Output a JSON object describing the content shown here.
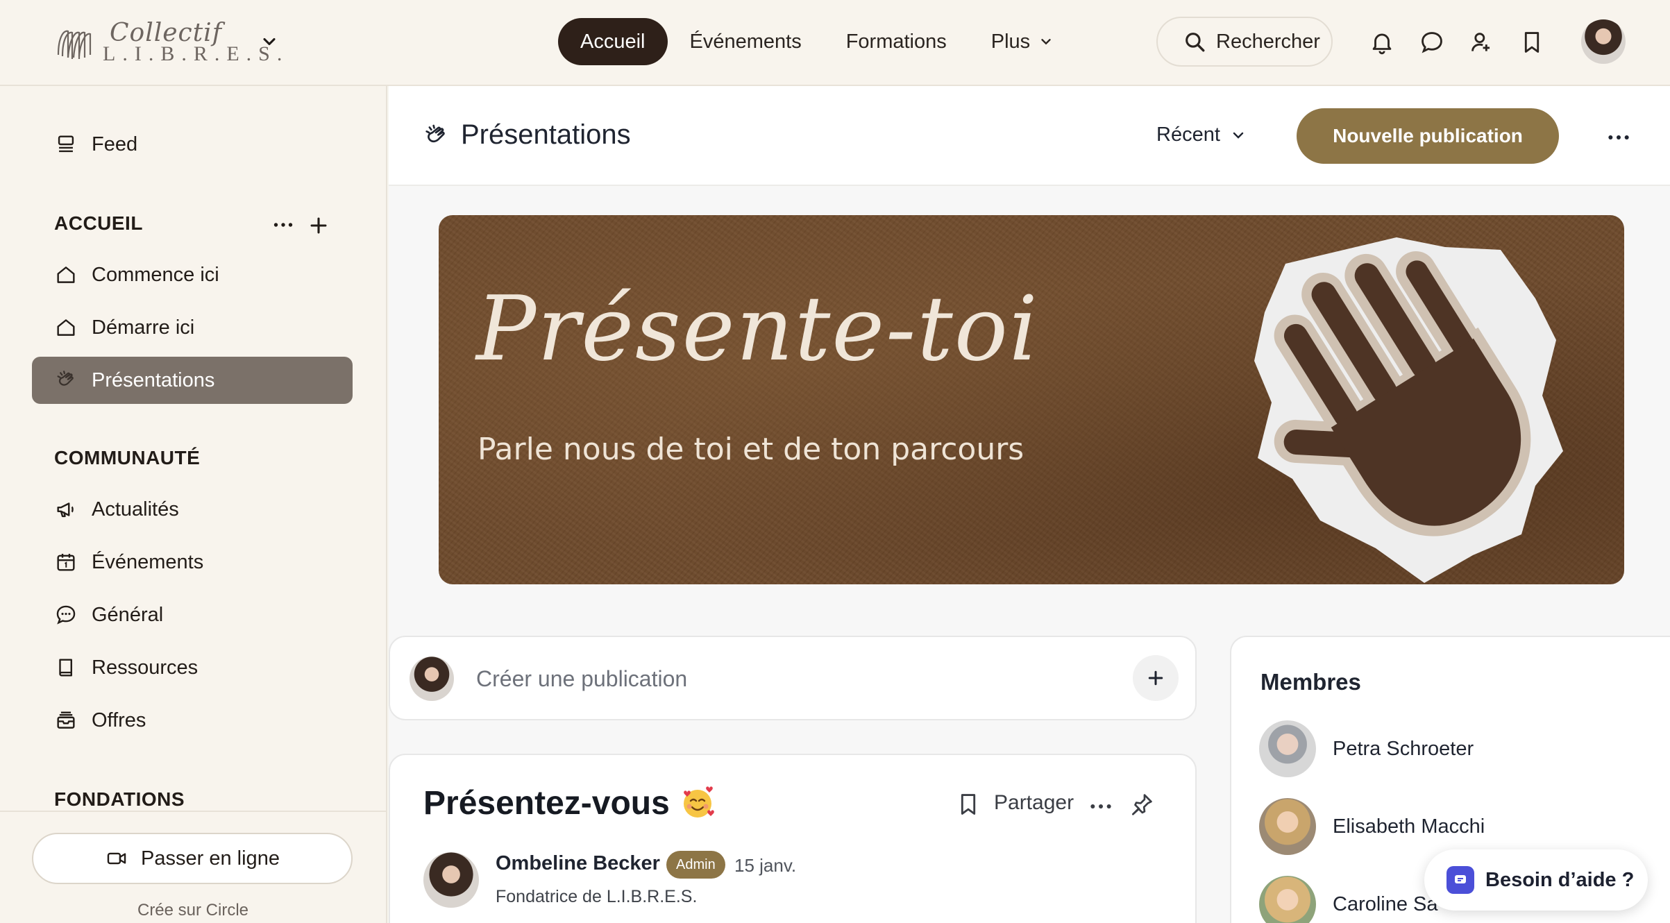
{
  "brand": {
    "script": "Collectif",
    "caps": "L.I.B.R.E.S."
  },
  "nav": {
    "items": [
      {
        "label": "Accueil",
        "active": true
      },
      {
        "label": "Événements",
        "active": false
      },
      {
        "label": "Formations",
        "active": false
      },
      {
        "label": "Plus",
        "active": false,
        "dropdown": true
      }
    ],
    "search_label": "Rechercher",
    "icons": [
      "bell-icon",
      "chat-bubble-icon",
      "user-plus-icon",
      "bookmark-icon"
    ]
  },
  "sidebar": {
    "feed": {
      "label": "Feed",
      "icon": "feed-icon"
    },
    "sections": [
      {
        "title": "ACCUEIL",
        "items": [
          {
            "label": "Commence ici",
            "icon": "home-icon"
          },
          {
            "label": "Démarre ici",
            "icon": "home-icon"
          },
          {
            "label": "Présentations",
            "icon": "wave-hand-icon",
            "active": true
          }
        ]
      },
      {
        "title": "COMMUNAUTÉ",
        "items": [
          {
            "label": "Actualités",
            "icon": "megaphone-icon"
          },
          {
            "label": "Événements",
            "icon": "calendar-icon"
          },
          {
            "label": "Général",
            "icon": "chat-dots-icon"
          },
          {
            "label": "Ressources",
            "icon": "book-icon"
          },
          {
            "label": "Offres",
            "icon": "inbox-icon"
          }
        ]
      },
      {
        "title": "FONDATIONS",
        "items": []
      }
    ],
    "live_button": "Passer en ligne",
    "circle_note": "Crée sur Circle"
  },
  "space": {
    "title": "Présentations",
    "sort_label": "Récent",
    "new_post_label": "Nouvelle publication"
  },
  "banner": {
    "title": "Présente-toi",
    "subtitle": "Parle nous de toi et de ton parcours"
  },
  "composer": {
    "placeholder": "Créer une publication"
  },
  "post": {
    "title": "Présentez-vous",
    "share_label": "Partager",
    "author": "Ombeline Becker",
    "badge": "Admin",
    "date": "15 janv.",
    "role": "Fondatrice de L.I.B.R.E.S."
  },
  "members": {
    "title": "Membres",
    "list": [
      {
        "name": "Petra Schroeter"
      },
      {
        "name": "Elisabeth Macchi"
      },
      {
        "name": "Caroline Sa"
      }
    ]
  },
  "help": {
    "label": "Besoin d’aide ?"
  },
  "colors": {
    "accent": "#8d7546",
    "nav_active": "#2e2019",
    "sidebar_active": "#7b7169",
    "banner": "#6e4a2c",
    "help_icon": "#4b4fd8"
  }
}
